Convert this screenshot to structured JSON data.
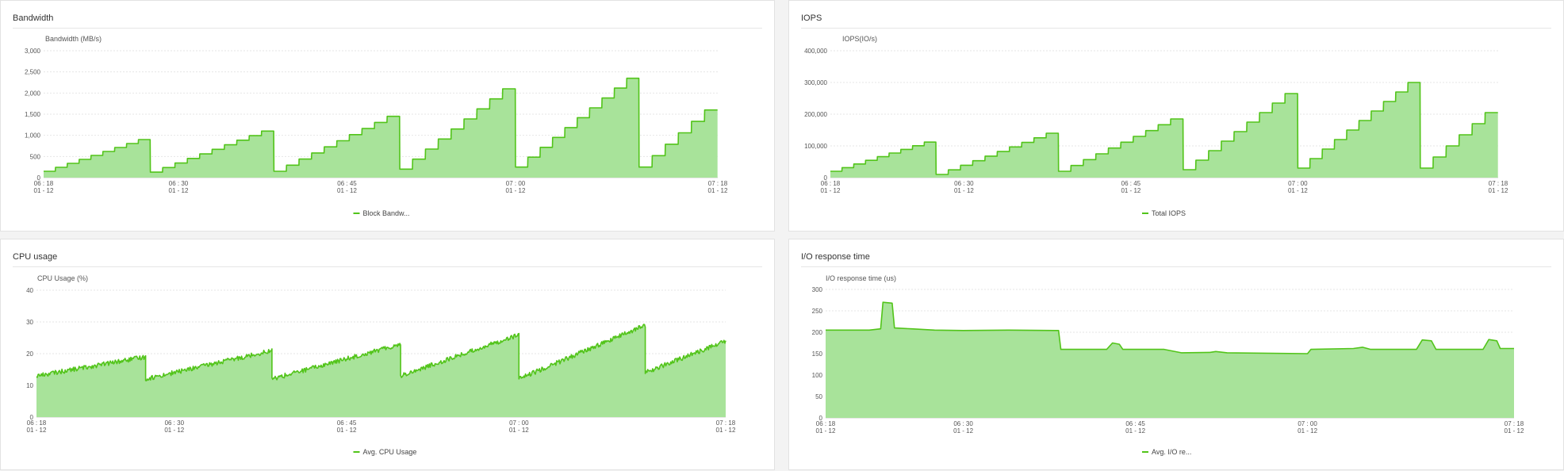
{
  "accent_color": "#52c41a",
  "fill_color": "#a8e39a",
  "chart_data": [
    {
      "type": "area",
      "panel_title": "Bandwidth",
      "ylabel": "Bandwidth (MB/s)",
      "series_name": "Block Bandw...",
      "ylim": [
        0,
        3000
      ],
      "yticks": [
        "0",
        "500",
        "1,000",
        "1,500",
        "2,000",
        "2,500",
        "3,000"
      ],
      "xticks": [
        {
          "t": 0,
          "time": "06 : 18",
          "date": "01 - 12"
        },
        {
          "t": 12,
          "time": "06 : 30",
          "date": "01 - 12"
        },
        {
          "t": 27,
          "time": "06 : 45",
          "date": "01 - 12"
        },
        {
          "t": 42,
          "time": "07 : 00",
          "date": "01 - 12"
        },
        {
          "t": 60,
          "time": "07 : 18",
          "date": "01 - 12"
        }
      ],
      "cycles": [
        {
          "start": 0,
          "end": 9.5,
          "from": 150,
          "to": 900
        },
        {
          "start": 9.5,
          "end": 20.5,
          "from": 130,
          "to": 1100
        },
        {
          "start": 20.5,
          "end": 31.7,
          "from": 150,
          "to": 1450
        },
        {
          "start": 31.7,
          "end": 42.0,
          "from": 200,
          "to": 2100
        },
        {
          "start": 42.0,
          "end": 53.0,
          "from": 250,
          "to": 2350
        },
        {
          "start": 53.0,
          "end": 60.0,
          "from": 250,
          "to": 1600
        }
      ],
      "stepped": true
    },
    {
      "type": "area",
      "panel_title": "IOPS",
      "ylabel": "IOPS(IO/s)",
      "series_name": "Total IOPS",
      "ylim": [
        0,
        400000
      ],
      "yticks": [
        "0",
        "100,000",
        "200,000",
        "300,000",
        "400,000"
      ],
      "xticks": [
        {
          "t": 0,
          "time": "06 : 18",
          "date": "01 - 12"
        },
        {
          "t": 12,
          "time": "06 : 30",
          "date": "01 - 12"
        },
        {
          "t": 27,
          "time": "06 : 45",
          "date": "01 - 12"
        },
        {
          "t": 42,
          "time": "07 : 00",
          "date": "01 - 12"
        },
        {
          "t": 60,
          "time": "07 : 18",
          "date": "01 - 12"
        }
      ],
      "cycles": [
        {
          "start": 0,
          "end": 9.5,
          "from": 20000,
          "to": 112000
        },
        {
          "start": 9.5,
          "end": 20.5,
          "from": 10000,
          "to": 140000
        },
        {
          "start": 20.5,
          "end": 31.7,
          "from": 20000,
          "to": 185000
        },
        {
          "start": 31.7,
          "end": 42.0,
          "from": 25000,
          "to": 265000
        },
        {
          "start": 42.0,
          "end": 53.0,
          "from": 30000,
          "to": 300000
        },
        {
          "start": 53.0,
          "end": 60.0,
          "from": 30000,
          "to": 205000
        }
      ],
      "stepped": true
    },
    {
      "type": "area",
      "panel_title": "CPU usage",
      "ylabel": "CPU Usage (%)",
      "series_name": "Avg. CPU Usage",
      "ylim": [
        0,
        40
      ],
      "yticks": [
        "0",
        "10",
        "20",
        "30",
        "40"
      ],
      "xticks": [
        {
          "t": 0,
          "time": "06 : 18",
          "date": "01 - 12"
        },
        {
          "t": 12,
          "time": "06 : 30",
          "date": "01 - 12"
        },
        {
          "t": 27,
          "time": "06 : 45",
          "date": "01 - 12"
        },
        {
          "t": 42,
          "time": "07 : 00",
          "date": "01 - 12"
        },
        {
          "t": 60,
          "time": "07 : 18",
          "date": "01 - 12"
        }
      ],
      "cycles": [
        {
          "start": 0,
          "end": 9.5,
          "from": 13,
          "to": 19
        },
        {
          "start": 9.5,
          "end": 20.5,
          "from": 12,
          "to": 21
        },
        {
          "start": 20.5,
          "end": 31.7,
          "from": 12,
          "to": 23
        },
        {
          "start": 31.7,
          "end": 42.0,
          "from": 13,
          "to": 26
        },
        {
          "start": 42.0,
          "end": 53.0,
          "from": 12,
          "to": 29
        },
        {
          "start": 53.0,
          "end": 60.0,
          "from": 14,
          "to": 24
        }
      ],
      "stepped": false
    },
    {
      "type": "area",
      "panel_title": "I/O response time",
      "ylabel": "I/O response time (us)",
      "series_name": "Avg. I/O re...",
      "ylim": [
        0,
        300
      ],
      "yticks": [
        "0",
        "50",
        "100",
        "150",
        "200",
        "250",
        "300"
      ],
      "xticks": [
        {
          "t": 0,
          "time": "06 : 18",
          "date": "01 - 12"
        },
        {
          "t": 12,
          "time": "06 : 30",
          "date": "01 - 12"
        },
        {
          "t": 27,
          "time": "06 : 45",
          "date": "01 - 12"
        },
        {
          "t": 42,
          "time": "07 : 00",
          "date": "01 - 12"
        },
        {
          "t": 60,
          "time": "07 : 18",
          "date": "01 - 12"
        }
      ],
      "points": [
        [
          0,
          205
        ],
        [
          3.8,
          205
        ],
        [
          4.8,
          208
        ],
        [
          5.0,
          270
        ],
        [
          5.8,
          268
        ],
        [
          6.0,
          210
        ],
        [
          7.5,
          208
        ],
        [
          9.5,
          205
        ],
        [
          12,
          204
        ],
        [
          16,
          205
        ],
        [
          20,
          204
        ],
        [
          20.3,
          204
        ],
        [
          20.5,
          160
        ],
        [
          24.5,
          160
        ],
        [
          25.0,
          175
        ],
        [
          25.6,
          172
        ],
        [
          25.9,
          160
        ],
        [
          29.5,
          160
        ],
        [
          31.0,
          152
        ],
        [
          33.5,
          153
        ],
        [
          34.0,
          155
        ],
        [
          35.0,
          152
        ],
        [
          42,
          150
        ],
        [
          42.3,
          160
        ],
        [
          46,
          162
        ],
        [
          46.8,
          165
        ],
        [
          47.5,
          160
        ],
        [
          51.5,
          160
        ],
        [
          52.0,
          182
        ],
        [
          52.8,
          180
        ],
        [
          53.2,
          160
        ],
        [
          57.3,
          160
        ],
        [
          57.8,
          183
        ],
        [
          58.5,
          180
        ],
        [
          58.8,
          162
        ],
        [
          60,
          162
        ]
      ]
    }
  ]
}
